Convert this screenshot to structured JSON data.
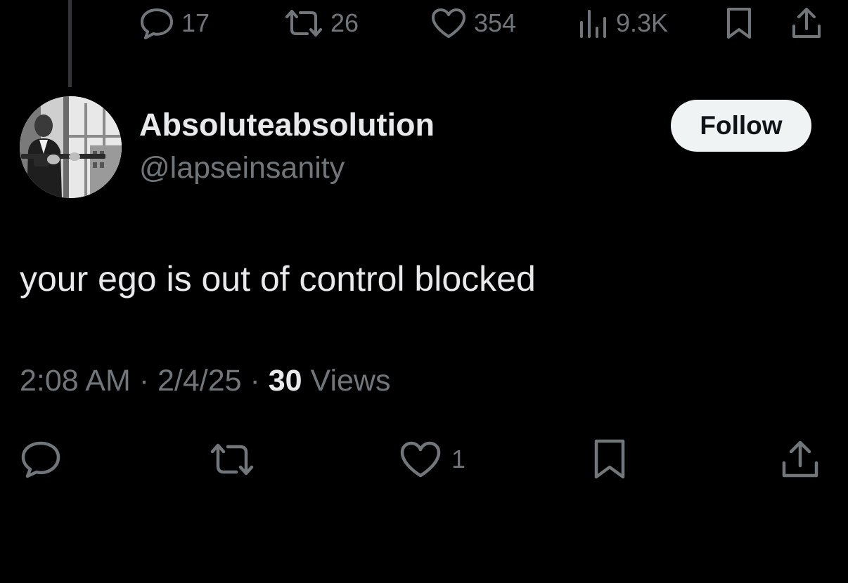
{
  "top_actions": {
    "replies": "17",
    "reposts": "26",
    "likes": "354",
    "views": "9.3K"
  },
  "tweet": {
    "display_name": "Absoluteabsolution",
    "handle": "@lapseinsanity",
    "follow_label": "Follow",
    "text": "your ego is out of control blocked",
    "time": "2:08 AM",
    "separator": " · ",
    "date": "2/4/25",
    "views_count": "30",
    "views_label": " Views"
  },
  "bottom_actions": {
    "likes": "1"
  },
  "colors": {
    "background": "#000000",
    "primary_text": "#e7e9ea",
    "secondary_text": "#71767b",
    "follow_button_bg": "#eff3f4",
    "thread_line": "#333639"
  },
  "icons": [
    "reply-icon",
    "repost-icon",
    "like-icon",
    "views-icon",
    "bookmark-icon",
    "share-icon"
  ]
}
